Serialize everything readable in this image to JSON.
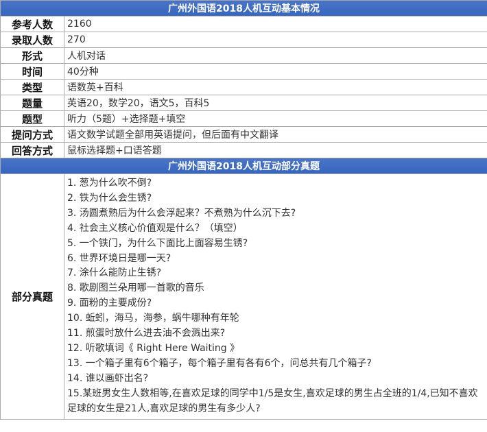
{
  "section1": {
    "title": "广州外国语2018人机互动基本情况",
    "rows": [
      {
        "label": "参考人数",
        "value": "2160"
      },
      {
        "label": "录取人数",
        "value": "270"
      },
      {
        "label": "形式",
        "value": "人机对话"
      },
      {
        "label": "时间",
        "value": "40分种"
      },
      {
        "label": "类型",
        "value": "语数英+百科"
      },
      {
        "label": "题量",
        "value": "英语20，数学20，语文5，百科5"
      },
      {
        "label": "题型",
        "value": "听力（5题）+选择题+填空"
      },
      {
        "label": "提问方式",
        "value": "语文数学试题全部用英语提问，但后面有中文翻译"
      },
      {
        "label": "回答方式",
        "value": "鼠标选择题+口语答题"
      }
    ]
  },
  "section2": {
    "title": "广州外国语2018人机互动部分真题",
    "label": "部分真题",
    "questions": [
      "1. 葱为什么吹不倒?",
      "2. 铁为什么会生锈?",
      "3. 汤圆煮熟后为什么会浮起来？不煮熟为什么沉下去?",
      "4. 社会主义核心价值观是什么？（填空）",
      "5. 一个铁门，为什么下面比上面容易生锈?",
      "6. 世界环境日是哪一天?",
      "7. 涂什么能防止生锈?",
      "8. 歌剧图兰朵用哪一首歌的音乐",
      "9. 面粉的主要成份?",
      "10. 蚯蚓，海马，海参，蜗牛哪种有年轮",
      "11. 煎蛋时放什么进去油不会溅出来?",
      "12. 听歌填词《 Right Here Waiting 》",
      "13. 一个箱子里有6个箱子，每个箱子里有各有6个，问总共有几个箱子?",
      "14. 谁以画虾出名?",
      "15.某班男女生人数相等,在喜欢足球的同学中1/5是女生,喜欢足球的男生占全班的1/4,已知不喜欢足球的女生是21人,喜欢足球的男生有多少人?"
    ]
  }
}
